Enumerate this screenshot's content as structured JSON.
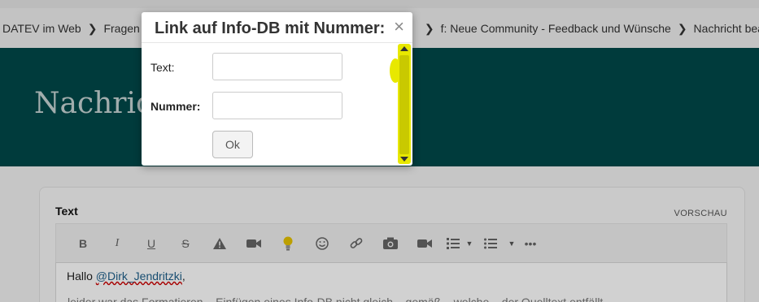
{
  "breadcrumb": {
    "items": [
      "DATEV im Web",
      "Fragen",
      "f: Neue Community - Feedback und Wünsche",
      "Nachricht bean"
    ]
  },
  "banner": {
    "title": "Nachricht"
  },
  "editor": {
    "label": "Text",
    "preview": "VORSCHAU",
    "greeting_prefix": "Hallo ",
    "mention": "@Dirk_Jendritzki",
    "greeting_suffix": ",",
    "second_line": "leider war das Formatieren... Einfügen eines Info-DB nicht gleich... gemäß... welche... der Quelltext entfällt..."
  },
  "toolbar": {
    "icons": [
      "bold-icon",
      "italic-icon",
      "underline-icon",
      "strikethrough-icon",
      "warning-icon",
      "video-icon",
      "lightbulb-icon",
      "emoji-icon",
      "link-icon",
      "camera-icon",
      "video-camera-icon",
      "ordered-list-icon",
      "unordered-list-icon",
      "more-icon"
    ]
  },
  "dialog": {
    "title": "Link auf Info-DB mit Nummer:",
    "close": "×",
    "text_label": "Text:",
    "text_value": "",
    "number_label": "Nummer:",
    "number_value": "",
    "ok_label": "Ok"
  },
  "colors": {
    "banner": "#00484a",
    "highlight": "#e8e800"
  }
}
